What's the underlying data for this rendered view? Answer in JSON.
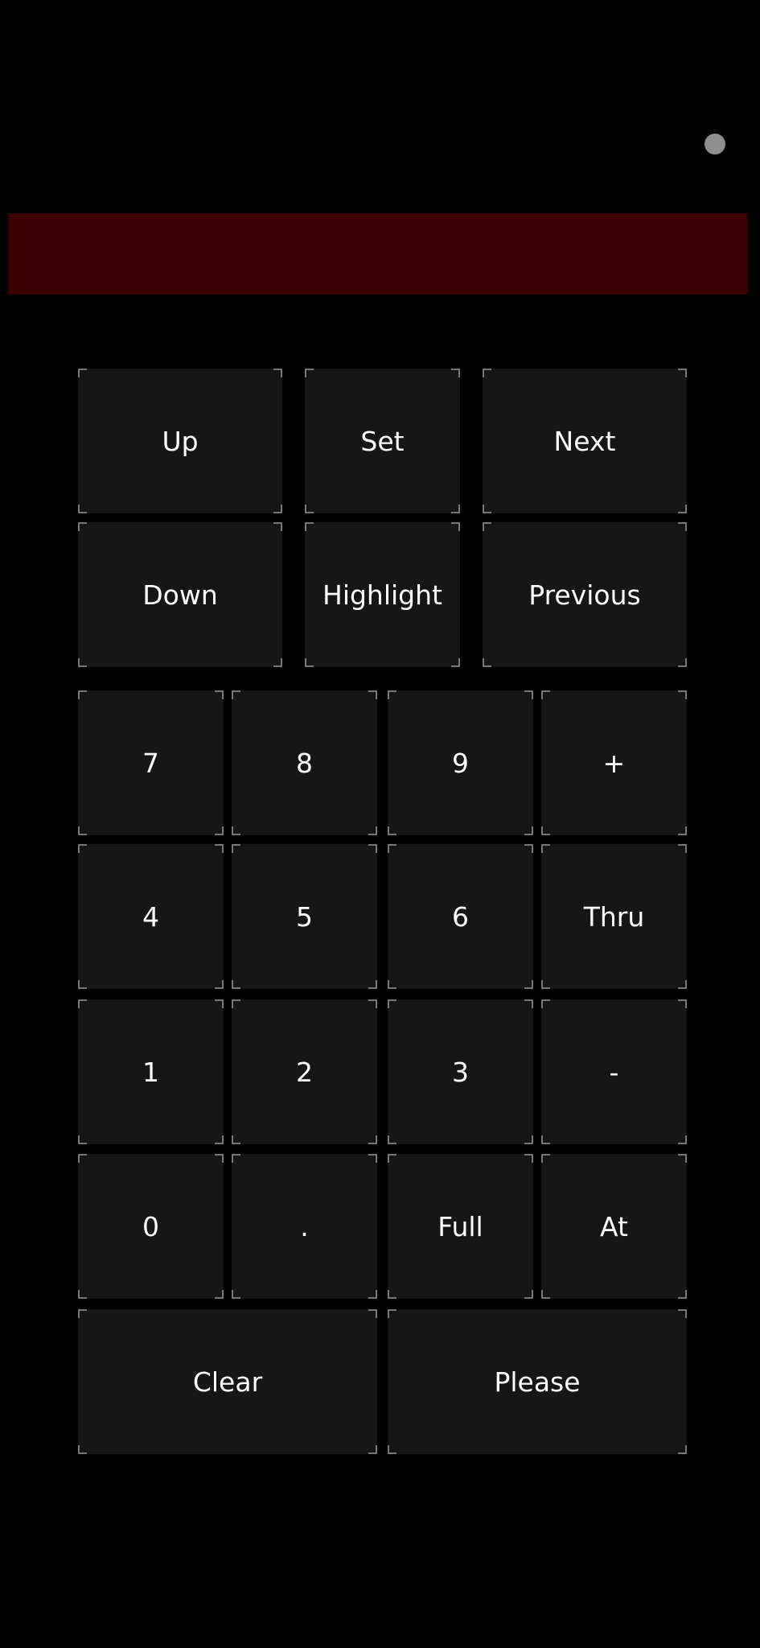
{
  "command_line": {
    "text": ""
  },
  "nav": {
    "up": "Up",
    "set": "Set",
    "next": "Next",
    "down": "Down",
    "highlight": "Highlight",
    "previous": "Previous"
  },
  "keypad": {
    "k7": "7",
    "k8": "8",
    "k9": "9",
    "plus": "+",
    "k4": "4",
    "k5": "5",
    "k6": "6",
    "thru": "Thru",
    "k1": "1",
    "k2": "2",
    "k3": "3",
    "minus": "-",
    "k0": "0",
    "dot": ".",
    "full": "Full",
    "at": "At",
    "clear": "Clear",
    "please": "Please"
  },
  "colors": {
    "background": "#000000",
    "command_line_bg": "#3d0000",
    "key_bg": "#161616",
    "key_corner": "#777777",
    "status_dot": "#8e8e8e"
  }
}
